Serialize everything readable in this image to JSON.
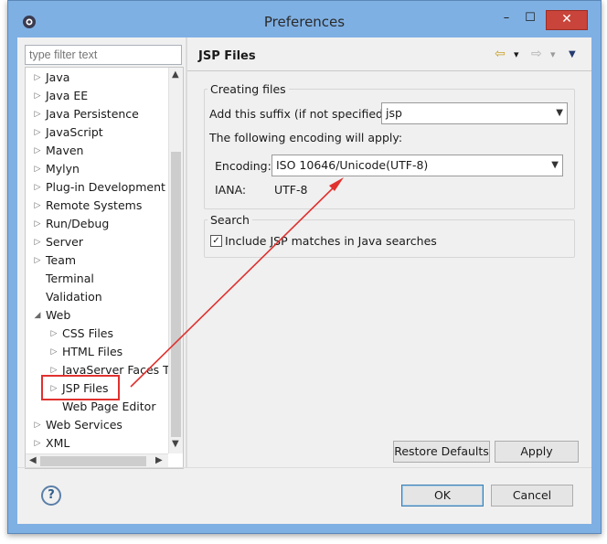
{
  "window": {
    "title": "Preferences",
    "minimize": "–",
    "maximize": "☐",
    "close": "✕"
  },
  "filter": {
    "placeholder": "type filter text"
  },
  "tree": {
    "items": [
      {
        "label": "Java",
        "twisty": "▷",
        "indent": 0
      },
      {
        "label": "Java EE",
        "twisty": "▷",
        "indent": 0
      },
      {
        "label": "Java Persistence",
        "twisty": "▷",
        "indent": 0
      },
      {
        "label": "JavaScript",
        "twisty": "▷",
        "indent": 0
      },
      {
        "label": "Maven",
        "twisty": "▷",
        "indent": 0
      },
      {
        "label": "Mylyn",
        "twisty": "▷",
        "indent": 0
      },
      {
        "label": "Plug-in Development",
        "twisty": "▷",
        "indent": 0
      },
      {
        "label": "Remote Systems",
        "twisty": "▷",
        "indent": 0
      },
      {
        "label": "Run/Debug",
        "twisty": "▷",
        "indent": 0
      },
      {
        "label": "Server",
        "twisty": "▷",
        "indent": 0
      },
      {
        "label": "Team",
        "twisty": "▷",
        "indent": 0
      },
      {
        "label": "Terminal",
        "twisty": "",
        "indent": 0
      },
      {
        "label": "Validation",
        "twisty": "",
        "indent": 0
      },
      {
        "label": "Web",
        "twisty": "◢",
        "indent": 0
      },
      {
        "label": "CSS Files",
        "twisty": "▷",
        "indent": 1
      },
      {
        "label": "HTML Files",
        "twisty": "▷",
        "indent": 1
      },
      {
        "label": "JavaServer Faces T",
        "twisty": "▷",
        "indent": 1
      },
      {
        "label": "JSP Files",
        "twisty": "▷",
        "indent": 1
      },
      {
        "label": "Web Page Editor",
        "twisty": "",
        "indent": 1
      },
      {
        "label": "Web Services",
        "twisty": "▷",
        "indent": 0
      },
      {
        "label": "XML",
        "twisty": "▷",
        "indent": 0
      }
    ]
  },
  "page": {
    "title": "JSP Files",
    "nav": {
      "back": "⇦",
      "back_menu": "▾",
      "forward": "⇨",
      "forward_menu": "▾",
      "view_menu": "▼"
    }
  },
  "creating_files": {
    "group_label": "Creating files",
    "suffix_label": "Add this suffix (if not specified):",
    "suffix_value": "jsp",
    "encoding_note": "The following encoding will apply:",
    "encoding_label": "Encoding:",
    "encoding_value": "ISO 10646/Unicode(UTF-8)",
    "iana_label": "IANA:",
    "iana_value": "UTF-8"
  },
  "search": {
    "group_label": "Search",
    "include_label": "Include JSP matches in Java searches",
    "checked": "✓"
  },
  "buttons": {
    "restore": "Restore Defaults",
    "apply": "Apply",
    "ok": "OK",
    "cancel": "Cancel",
    "help": "?"
  },
  "colors": {
    "annotation": "#e0312f",
    "frame": "#7fb0e3"
  }
}
